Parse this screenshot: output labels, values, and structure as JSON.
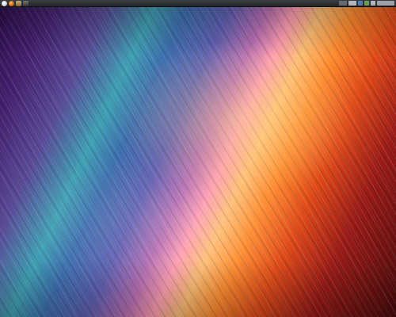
{
  "panel": {
    "launchers": [
      {
        "icon": "app-menu-icon"
      },
      {
        "icon": "browser-icon"
      },
      {
        "icon": "file-manager-icon"
      },
      {
        "icon": "terminal-icon"
      }
    ],
    "tray": [
      {
        "icon": "network-icon"
      },
      {
        "icon": "workspace-switcher-icon"
      },
      {
        "icon": "window-list-icon"
      },
      {
        "icon": "volume-icon"
      },
      {
        "icon": "battery-icon"
      },
      {
        "icon": "power-icon"
      }
    ]
  },
  "desktop": {
    "wallpaper": "abstract-diagonal-light-streaks",
    "colors": {
      "purple": "#44216f",
      "blue": "#3d6fb0",
      "orange": "#ff8b2e",
      "red": "#9a1b17"
    }
  }
}
